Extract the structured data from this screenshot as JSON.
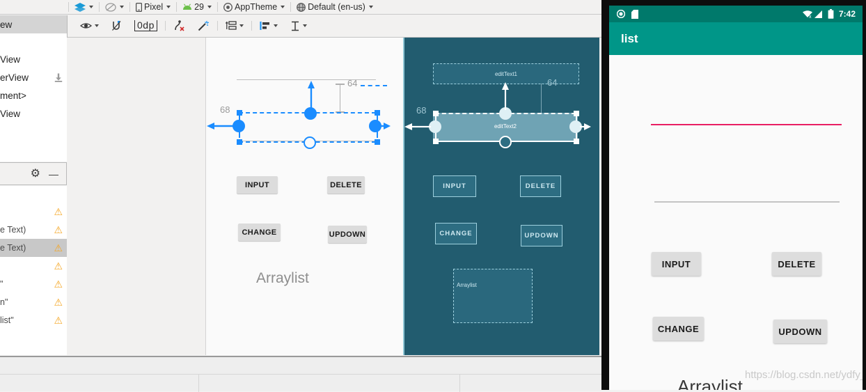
{
  "ide": {
    "toolbar_row1": {
      "left_icons": [
        {
          "name": "search-icon",
          "glyph": "⌕"
        },
        {
          "name": "gear-icon",
          "glyph": "⚙"
        },
        {
          "name": "minimize-icon",
          "glyph": "—"
        }
      ],
      "items": [
        {
          "name": "design-mode-selector",
          "glyph": "⯆",
          "label": "",
          "caret": true
        },
        {
          "name": "blueprint-mode-selector",
          "glyph": "◔",
          "label": "",
          "caret": true
        },
        {
          "name": "device-selector",
          "glyph": "▢",
          "label": "Pixel",
          "caret": true
        },
        {
          "name": "api-level-selector",
          "glyph": "▲",
          "label": "29",
          "caret": true
        },
        {
          "name": "theme-selector",
          "glyph": "◉",
          "label": "AppTheme",
          "caret": true
        },
        {
          "name": "locale-selector",
          "glyph": "◌",
          "label": "Default (en-us)",
          "caret": true
        }
      ]
    },
    "toolbar_row2": {
      "items": [
        {
          "name": "view-options-icon",
          "glyph": "◉",
          "caret": true
        },
        {
          "name": "autoconnect-off-icon",
          "glyph": "⊘",
          "caret": false
        },
        {
          "name": "default-margin-chip",
          "label": "0dp",
          "caret": false
        },
        {
          "name": "clear-constraints-icon",
          "glyph": "ʃ",
          "caret": false
        },
        {
          "name": "infer-constraints-icon",
          "glyph": "✨",
          "caret": false
        },
        {
          "name": "guidelines-icon",
          "glyph": "≡",
          "caret": true
        },
        {
          "name": "align-icon",
          "glyph": "▐",
          "caret": true
        },
        {
          "name": "distribute-vertical-icon",
          "glyph": "↕",
          "caret": true
        }
      ]
    },
    "palette": {
      "rows": [
        {
          "label": "ew",
          "selected": true,
          "download": false
        },
        {
          "label": "",
          "selected": false,
          "download": false
        },
        {
          "label": "View",
          "selected": false,
          "download": false
        },
        {
          "label": "erView",
          "selected": false,
          "download": true
        },
        {
          "label": "ment>",
          "selected": false,
          "download": false
        },
        {
          "label": "View",
          "selected": false,
          "download": false
        }
      ]
    },
    "component_tree_header": {
      "icons": [
        {
          "name": "gear-icon",
          "glyph": "⚙"
        },
        {
          "name": "minimize-icon",
          "glyph": "—"
        }
      ]
    },
    "component_tree": {
      "rows": [
        {
          "label": "",
          "warn": false,
          "selected": false
        },
        {
          "label": "",
          "warn": true,
          "selected": false
        },
        {
          "label": "e Text)",
          "warn": true,
          "selected": false
        },
        {
          "label": "e Text)",
          "warn": true,
          "selected": true
        },
        {
          "label": "",
          "warn": true,
          "selected": false
        },
        {
          "label": "\"",
          "warn": true,
          "selected": false
        },
        {
          "label": "n\"",
          "warn": true,
          "selected": false
        },
        {
          "label": "list\"",
          "warn": true,
          "selected": false
        }
      ]
    },
    "design_view": {
      "edit_text_label": "",
      "buttons": [
        {
          "name": "design-button-input",
          "label": "INPUT"
        },
        {
          "name": "design-button-delete",
          "label": "DELETE"
        },
        {
          "name": "design-button-change",
          "label": "CHANGE"
        },
        {
          "name": "design-button-updown",
          "label": "UPDOWN"
        }
      ],
      "arraylist_label": "Arraylist",
      "margin_left": "68",
      "margin_top": "64"
    },
    "blueprint_view": {
      "edit_text_1": "editText1",
      "edit_text_2": "editText2",
      "buttons": [
        {
          "name": "blueprint-button-input",
          "label": "INPUT"
        },
        {
          "name": "blueprint-button-delete",
          "label": "DELETE"
        },
        {
          "name": "blueprint-button-change",
          "label": "CHANGE"
        },
        {
          "name": "blueprint-button-updown",
          "label": "UPDOWN"
        }
      ],
      "arraylist_label": "Arraylist",
      "margin_left": "68",
      "margin_top": "64"
    }
  },
  "device": {
    "status_bar": {
      "time": "7:42",
      "left_icons": [
        {
          "name": "usb-debug-icon",
          "glyph": "◉"
        },
        {
          "name": "sd-card-icon",
          "glyph": "■"
        }
      ],
      "right_icons": [
        {
          "name": "wifi-off-icon",
          "glyph": "◢"
        },
        {
          "name": "signal-icon",
          "glyph": "◥"
        },
        {
          "name": "battery-icon",
          "glyph": "▮"
        }
      ]
    },
    "app_bar": {
      "title": "list"
    },
    "edit_texts": [
      {
        "name": "emulator-edittext-1",
        "focused": true
      },
      {
        "name": "emulator-edittext-2",
        "focused": false
      }
    ],
    "buttons": [
      {
        "name": "emulator-button-input",
        "label": "INPUT"
      },
      {
        "name": "emulator-button-delete",
        "label": "DELETE"
      },
      {
        "name": "emulator-button-change",
        "label": "CHANGE"
      },
      {
        "name": "emulator-button-updown",
        "label": "UPDOWN"
      }
    ],
    "arraylist_label": "Arraylist",
    "watermark": "https://blog.csdn.net/ydfy_"
  },
  "colors": {
    "accent_blue": "#1a8cff",
    "blueprint_bg": "#225c6f",
    "blueprint_stroke": "#9ed0de",
    "app_bar": "#009688",
    "status_bar": "#00796b",
    "focused_underline": "#e91e63",
    "unfocused_underline": "#c4c4c4",
    "warning": "#f5a623"
  }
}
